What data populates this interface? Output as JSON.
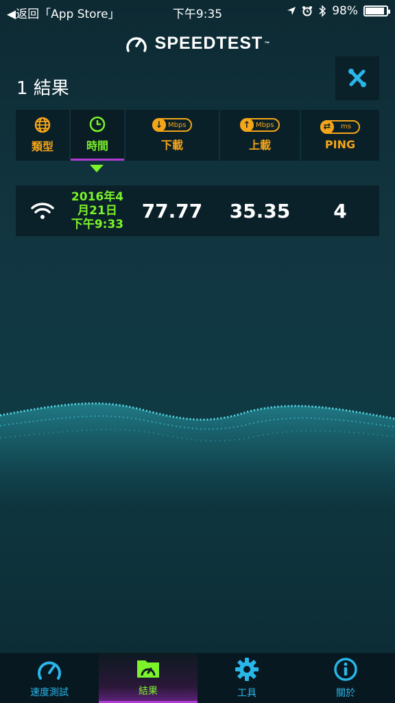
{
  "status_bar": {
    "back_label": "◀︎返回「App Store」",
    "time": "下午9:35",
    "battery": "98%",
    "battery_level": 0.98
  },
  "header": {
    "brand": "SPEEDTEST",
    "trademark": "™",
    "result_count": "1 結果",
    "tools_button_icon": "wrench-screwdriver-icon"
  },
  "sort_columns": [
    {
      "label": "類型",
      "icon": "globe-icon",
      "unit": ""
    },
    {
      "label": "時間",
      "icon": "clock-icon",
      "unit": ""
    },
    {
      "label": "下載",
      "icon": "download-arrow-icon",
      "unit": "Mbps"
    },
    {
      "label": "上載",
      "icon": "upload-arrow-icon",
      "unit": "Mbps"
    },
    {
      "label": "PING",
      "icon": "ping-arrows-icon",
      "unit": "ms"
    }
  ],
  "result": {
    "type_icon": "wifi-icon",
    "date_line1": "2016年4",
    "date_line2": "月21日",
    "date_line3": "下午9:33",
    "download": "77.77",
    "upload": "35.35",
    "ping": "4"
  },
  "tabs": [
    {
      "label": "速度測試",
      "icon": "speedometer-icon"
    },
    {
      "label": "結果",
      "icon": "results-folder-icon"
    },
    {
      "label": "工具",
      "icon": "gear-icon"
    },
    {
      "label": "關於",
      "icon": "info-icon"
    }
  ],
  "colors": {
    "accent_green": "#7cf32a",
    "accent_orange": "#f5a519",
    "accent_blue": "#29b6e9",
    "active_purple": "#b23bd6"
  }
}
